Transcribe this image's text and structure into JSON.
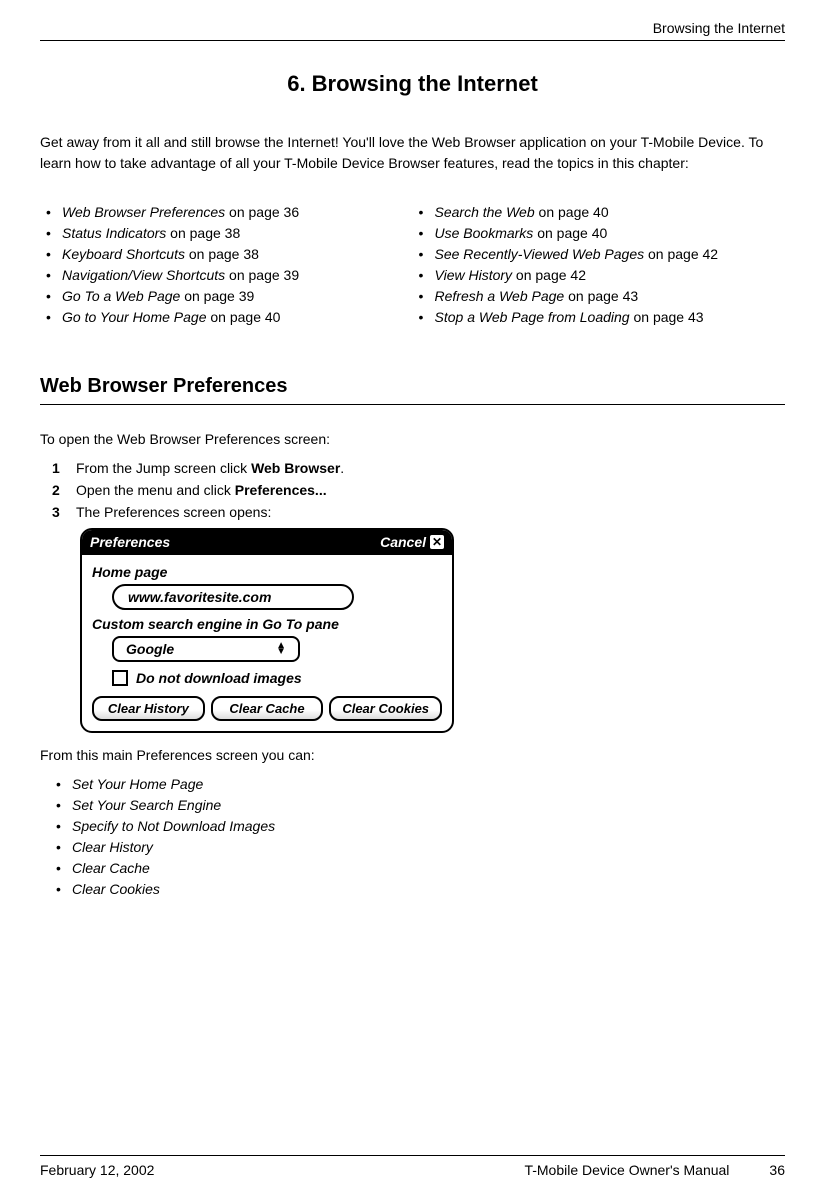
{
  "header": {
    "running_head": "Browsing the Internet"
  },
  "chapter": {
    "number_title": "6.  Browsing the Internet"
  },
  "intro": "Get away from it all and still browse the Internet! You'll love the Web Browser application on your T-Mobile Device. To learn how to take advantage of all your T-Mobile Device Browser features, read the topics in this chapter:",
  "toc": {
    "left": [
      {
        "label": "Web Browser Preferences",
        "suffix": " on page 36"
      },
      {
        "label": "Status Indicators",
        "suffix": " on page 38"
      },
      {
        "label": "Keyboard Shortcuts",
        "suffix": " on page 38"
      },
      {
        "label": "Navigation/View Shortcuts",
        "suffix": " on page 39"
      },
      {
        "label": "Go To a Web Page",
        "suffix": " on page 39"
      },
      {
        "label": "Go to Your Home Page",
        "suffix": " on page 40"
      }
    ],
    "right": [
      {
        "label": "Search the Web",
        "suffix": " on page 40"
      },
      {
        "label": "Use Bookmarks",
        "suffix": " on page 40"
      },
      {
        "label": "See Recently-Viewed Web Pages",
        "suffix": " on page 42"
      },
      {
        "label": "View History",
        "suffix": " on page 42"
      },
      {
        "label": "Refresh a Web Page",
        "suffix": " on page 43"
      },
      {
        "label": "Stop a Web Page from Loading",
        "suffix": " on page 43"
      }
    ]
  },
  "section": {
    "title": "Web Browser Preferences",
    "lead": "To open the Web Browser Preferences screen:",
    "steps": [
      {
        "num": "1",
        "pre": "From the Jump screen click ",
        "bold": "Web Browser",
        "post": "."
      },
      {
        "num": "2",
        "pre": "Open the menu and click ",
        "bold": "Preferences...",
        "post": ""
      },
      {
        "num": "3",
        "pre": "The Preferences screen opens:",
        "bold": "",
        "post": ""
      }
    ],
    "after_image": "From this main Preferences screen you can:",
    "bullets": [
      "Set Your Home Page",
      "Set Your Search Engine",
      "Specify to Not Download Images",
      "Clear History",
      "Clear Cache",
      "Clear Cookies"
    ]
  },
  "device": {
    "title": "Preferences",
    "cancel": "Cancel",
    "close_x": "✕",
    "homepage_label": "Home page",
    "homepage_value": "www.favoritesite.com",
    "search_label": "Custom search engine in Go To pane",
    "search_value": "Google",
    "checkbox_label": "Do not download images",
    "buttons": {
      "clear_history": "Clear History",
      "clear_cache": "Clear Cache",
      "clear_cookies": "Clear Cookies"
    }
  },
  "footer": {
    "date": "February 12, 2002",
    "manual": "T-Mobile Device Owner's Manual",
    "page": "36"
  }
}
